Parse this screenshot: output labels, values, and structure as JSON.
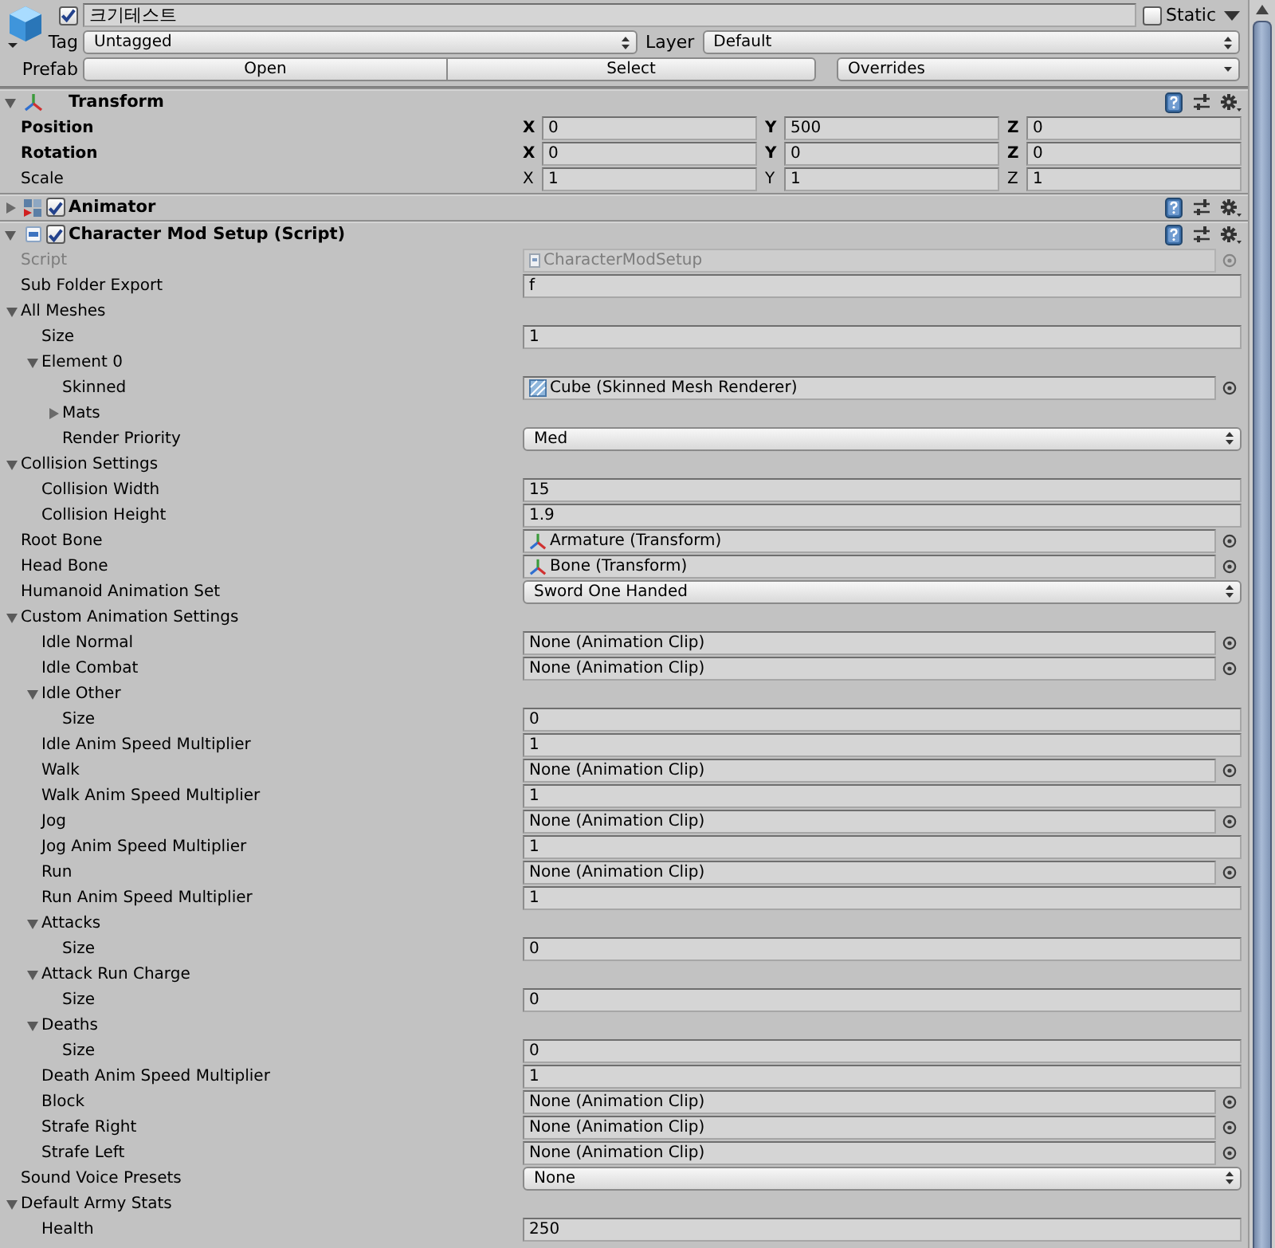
{
  "header": {
    "active": true,
    "name": "크기테스트",
    "static": false,
    "static_label": "Static",
    "tag_label": "Tag",
    "tag": "Untagged",
    "layer_label": "Layer",
    "layer": "Default",
    "prefab_label": "Prefab",
    "prefab_buttons": [
      "Open",
      "Select"
    ],
    "overrides": "Overrides"
  },
  "components": [
    {
      "kind": "transform",
      "title": "Transform",
      "expanded": true,
      "rows": [
        {
          "label": "Position",
          "overridden": true,
          "values": [
            {
              "axis": "X",
              "value": "0"
            },
            {
              "axis": "Y",
              "value": "500"
            },
            {
              "axis": "Z",
              "value": "0"
            }
          ]
        },
        {
          "label": "Rotation",
          "overridden": true,
          "values": [
            {
              "axis": "X",
              "value": "0"
            },
            {
              "axis": "Y",
              "value": "0"
            },
            {
              "axis": "Z",
              "value": "0"
            }
          ]
        },
        {
          "label": "Scale",
          "overridden": false,
          "values": [
            {
              "axis": "X",
              "value": "1"
            },
            {
              "axis": "Y",
              "value": "1"
            },
            {
              "axis": "Z",
              "value": "1"
            }
          ]
        }
      ]
    },
    {
      "kind": "animator",
      "title": "Animator",
      "expanded": false,
      "enabled": true
    },
    {
      "kind": "script",
      "title": "Character Mod Setup (Script)",
      "expanded": true,
      "enabled": true,
      "script": {
        "label": "Script",
        "value": "CharacterModSetup",
        "disabled": true
      },
      "properties": [
        {
          "kind": "text",
          "label": "Sub Folder Export",
          "value": "f"
        },
        {
          "kind": "foldout",
          "label": "All Meshes",
          "expanded": true,
          "children": [
            {
              "kind": "text",
              "label": "Size",
              "value": "1"
            },
            {
              "kind": "foldout",
              "label": "Element 0",
              "expanded": true,
              "children": [
                {
                  "kind": "mesh_ref",
                  "label": "Skinned",
                  "value": "Cube (Skinned Mesh Renderer)"
                },
                {
                  "kind": "foldout",
                  "label": "Mats",
                  "expanded": false
                },
                {
                  "kind": "popup",
                  "label": "Render Priority",
                  "value": "Med"
                }
              ]
            }
          ]
        },
        {
          "kind": "foldout",
          "label": "Collision Settings",
          "expanded": true,
          "children": [
            {
              "kind": "text",
              "label": "Collision Width",
              "value": "15"
            },
            {
              "kind": "text",
              "label": "Collision Height",
              "value": "1.9"
            }
          ]
        },
        {
          "kind": "transform_ref",
          "label": "Root Bone",
          "value": "Armature (Transform)"
        },
        {
          "kind": "transform_ref",
          "label": "Head Bone",
          "value": "Bone (Transform)"
        },
        {
          "kind": "popup",
          "label": "Humanoid Animation Set",
          "value": "Sword One Handed"
        },
        {
          "kind": "foldout",
          "label": "Custom Animation Settings",
          "expanded": true,
          "children": [
            {
              "kind": "object",
              "label": "Idle Normal",
              "value": "None (Animation Clip)"
            },
            {
              "kind": "object",
              "label": "Idle Combat",
              "value": "None (Animation Clip)"
            },
            {
              "kind": "foldout",
              "label": "Idle Other",
              "expanded": true,
              "children": [
                {
                  "kind": "text",
                  "label": "Size",
                  "value": "0"
                }
              ]
            },
            {
              "kind": "text",
              "label": "Idle Anim Speed Multiplier",
              "value": "1"
            },
            {
              "kind": "object",
              "label": "Walk",
              "value": "None (Animation Clip)"
            },
            {
              "kind": "text",
              "label": "Walk Anim Speed Multiplier",
              "value": "1"
            },
            {
              "kind": "object",
              "label": "Jog",
              "value": "None (Animation Clip)"
            },
            {
              "kind": "text",
              "label": "Jog Anim Speed Multiplier",
              "value": "1"
            },
            {
              "kind": "object",
              "label": "Run",
              "value": "None (Animation Clip)"
            },
            {
              "kind": "text",
              "label": "Run Anim Speed Multiplier",
              "value": "1"
            },
            {
              "kind": "foldout",
              "label": "Attacks",
              "expanded": true,
              "children": [
                {
                  "kind": "text",
                  "label": "Size",
                  "value": "0"
                }
              ]
            },
            {
              "kind": "foldout",
              "label": "Attack Run Charge",
              "expanded": true,
              "children": [
                {
                  "kind": "text",
                  "label": "Size",
                  "value": "0"
                }
              ]
            },
            {
              "kind": "foldout",
              "label": "Deaths",
              "expanded": true,
              "children": [
                {
                  "kind": "text",
                  "label": "Size",
                  "value": "0"
                }
              ]
            },
            {
              "kind": "text",
              "label": "Death Anim Speed Multiplier",
              "value": "1"
            },
            {
              "kind": "object",
              "label": "Block",
              "value": "None (Animation Clip)"
            },
            {
              "kind": "object",
              "label": "Strafe Right",
              "value": "None (Animation Clip)"
            },
            {
              "kind": "object",
              "label": "Strafe Left",
              "value": "None (Animation Clip)"
            }
          ]
        },
        {
          "kind": "popup",
          "label": "Sound Voice Presets",
          "value": "None"
        },
        {
          "kind": "foldout",
          "label": "Default Army Stats",
          "expanded": true,
          "children": [
            {
              "kind": "text",
              "label": "Health",
              "value": "250"
            }
          ]
        }
      ]
    }
  ]
}
